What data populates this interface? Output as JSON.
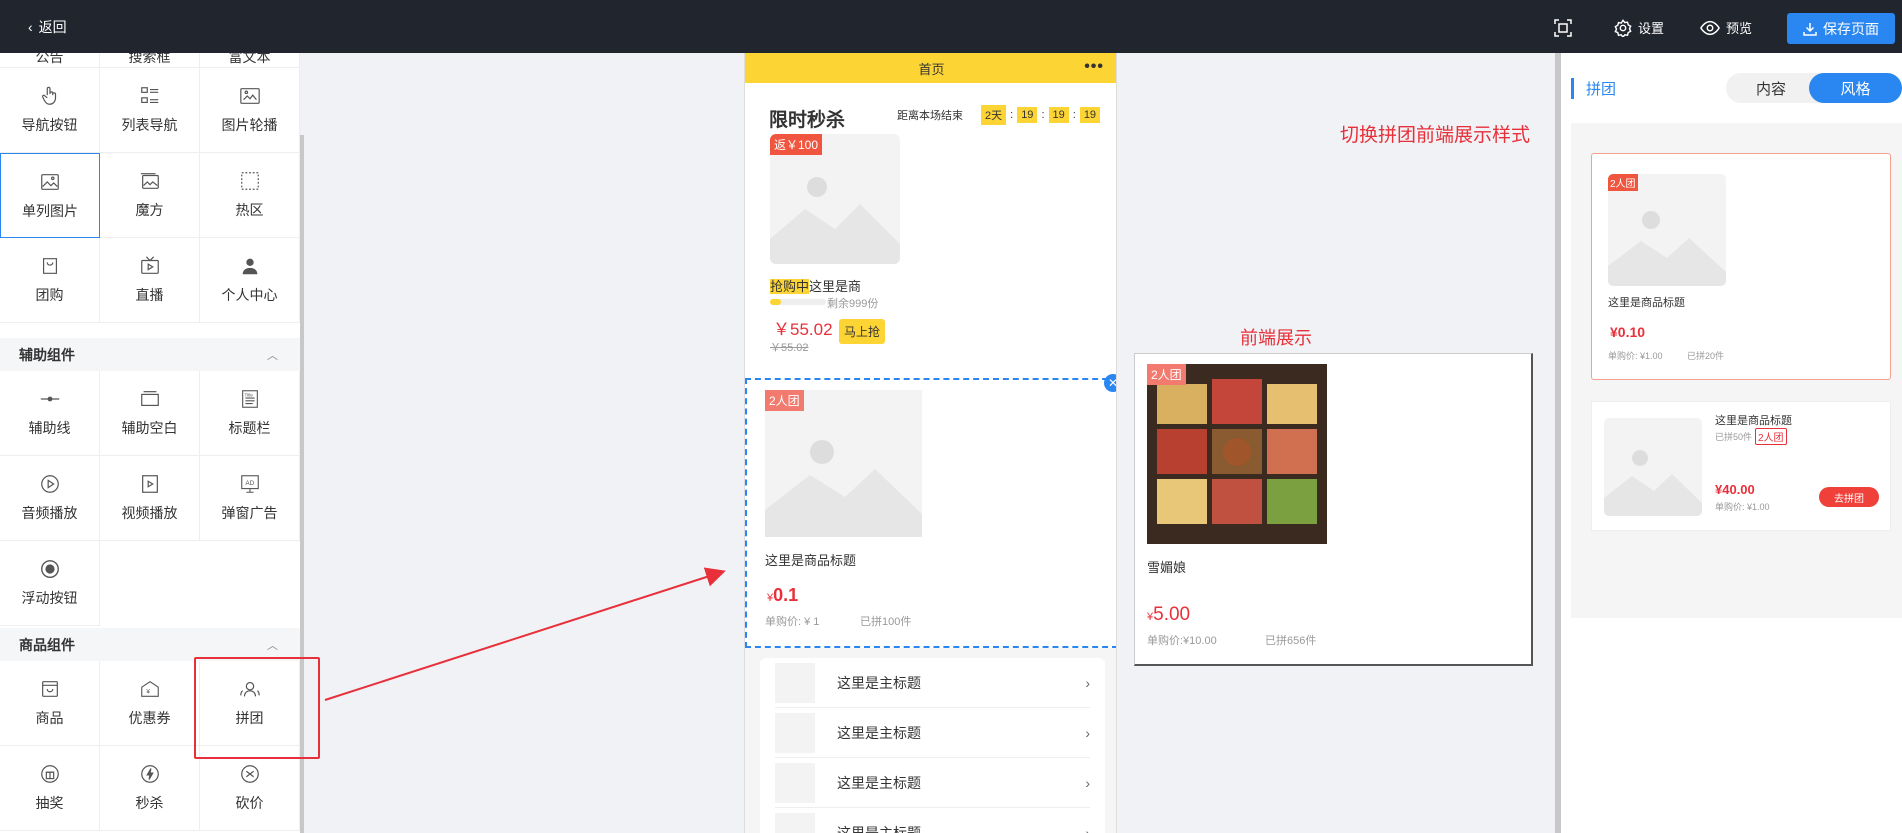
{
  "topbar": {
    "back_label": "返回",
    "settings_label": "设置",
    "preview_label": "预览",
    "save_label": "保存页面"
  },
  "left": {
    "top_partial": [
      "公告",
      "搜索框",
      "富文本"
    ],
    "basic_rows": [
      [
        "导航按钮",
        "列表导航",
        "图片轮播"
      ],
      [
        "单列图片",
        "魔方",
        "热区"
      ],
      [
        "团购",
        "直播",
        "个人中心"
      ]
    ],
    "aux_header": "辅助组件",
    "aux_rows": [
      [
        "辅助线",
        "辅助空白",
        "标题栏"
      ],
      [
        "音频播放",
        "视频播放",
        "弹窗广告"
      ],
      [
        "浮动按钮"
      ]
    ],
    "goods_header": "商品组件",
    "goods_rows": [
      [
        "商品",
        "优惠券",
        "拼团"
      ],
      [
        "抽奖",
        "秒杀",
        "砍价"
      ]
    ]
  },
  "phone": {
    "header_title": "首页",
    "header_dots": "•••",
    "flash": {
      "title": "限时秒杀",
      "countdown_label": "距离本场结束",
      "days": "2天",
      "h": "19",
      "m": "19",
      "s": "19",
      "tag": "返￥100",
      "badge": "抢购中",
      "name": "这里是商",
      "remain": "剩余999份",
      "price": "￥55.02",
      "old_price": "￥55.02",
      "buy_btn": "马上抢",
      "progress": 0.2
    },
    "group": {
      "tag": "2人团",
      "title": "这里是商品标题",
      "price_symbol": "¥",
      "price": "0.1",
      "single_price": "单购价: ¥ 1",
      "joined": "已拼100件",
      "close": "✕"
    },
    "list": {
      "items": [
        "这里是主标题",
        "这里是主标题",
        "这里是主标题",
        "这里是主标题"
      ]
    }
  },
  "front": {
    "label": "前端展示",
    "tag": "2人团",
    "name": "雪媚娘",
    "price_symbol": "¥",
    "price": "5.00",
    "single_price": "单购价:¥10.00",
    "joined": "已拼656件"
  },
  "right": {
    "title": "拼团",
    "tab_content": "内容",
    "tab_style": "风格",
    "style1": {
      "tag": "2人团",
      "title": "这里是商品标题",
      "price": "¥0.10",
      "single": "单购价: ¥1.00",
      "joined": "已拼20件"
    },
    "style2": {
      "title": "这里是商品标题",
      "joined": "已拼50件",
      "tag": "2人团",
      "price": "¥40.00",
      "single": "单购价: ¥1.00",
      "btn": "去拼团"
    }
  },
  "annotation": "切换拼团前端展示样式",
  "colors": {
    "accent": "#2a86f0",
    "red": "#e8303a",
    "yellow": "#fcd535",
    "topbar": "#21252e"
  }
}
